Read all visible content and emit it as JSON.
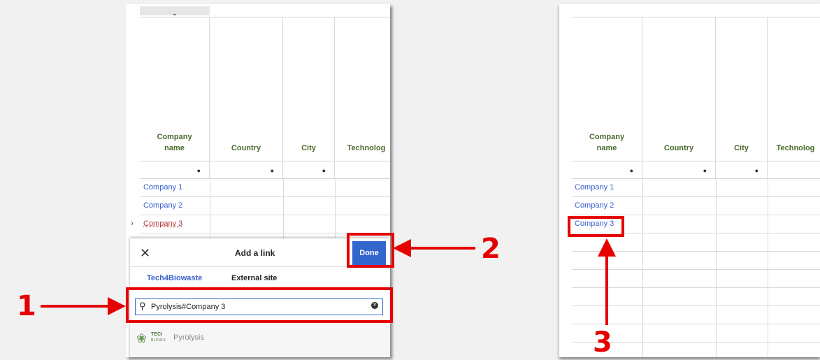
{
  "left_table": {
    "headers": [
      "Company\nname",
      "Country",
      "City",
      "Technolog"
    ],
    "rows": [
      "Company 1",
      "Company 2",
      "Company 3"
    ]
  },
  "right_table": {
    "headers": [
      "Company\nname",
      "Country",
      "City",
      "Technolog"
    ],
    "rows": [
      "Company 1",
      "Company 2",
      "Company 3"
    ]
  },
  "dialog": {
    "title": "Add a link",
    "done_label": "Done",
    "tabs": [
      "Tech4Biowaste",
      "External site"
    ],
    "search_value": "Pyrolysis#Company 3",
    "suggestion_logo_text": "TECI",
    "suggestion_logo_sub": "BIOWS",
    "suggestion_label": "Pyrolysis"
  },
  "annotations": {
    "step1": "1",
    "step2": "2",
    "step3": "3"
  },
  "colors": {
    "annotation_red": "#e60000",
    "link_blue": "#3a5fcd",
    "visited_red": "#b33a3a",
    "header_green": "#4a6a2a",
    "done_blue": "#3366cc"
  }
}
